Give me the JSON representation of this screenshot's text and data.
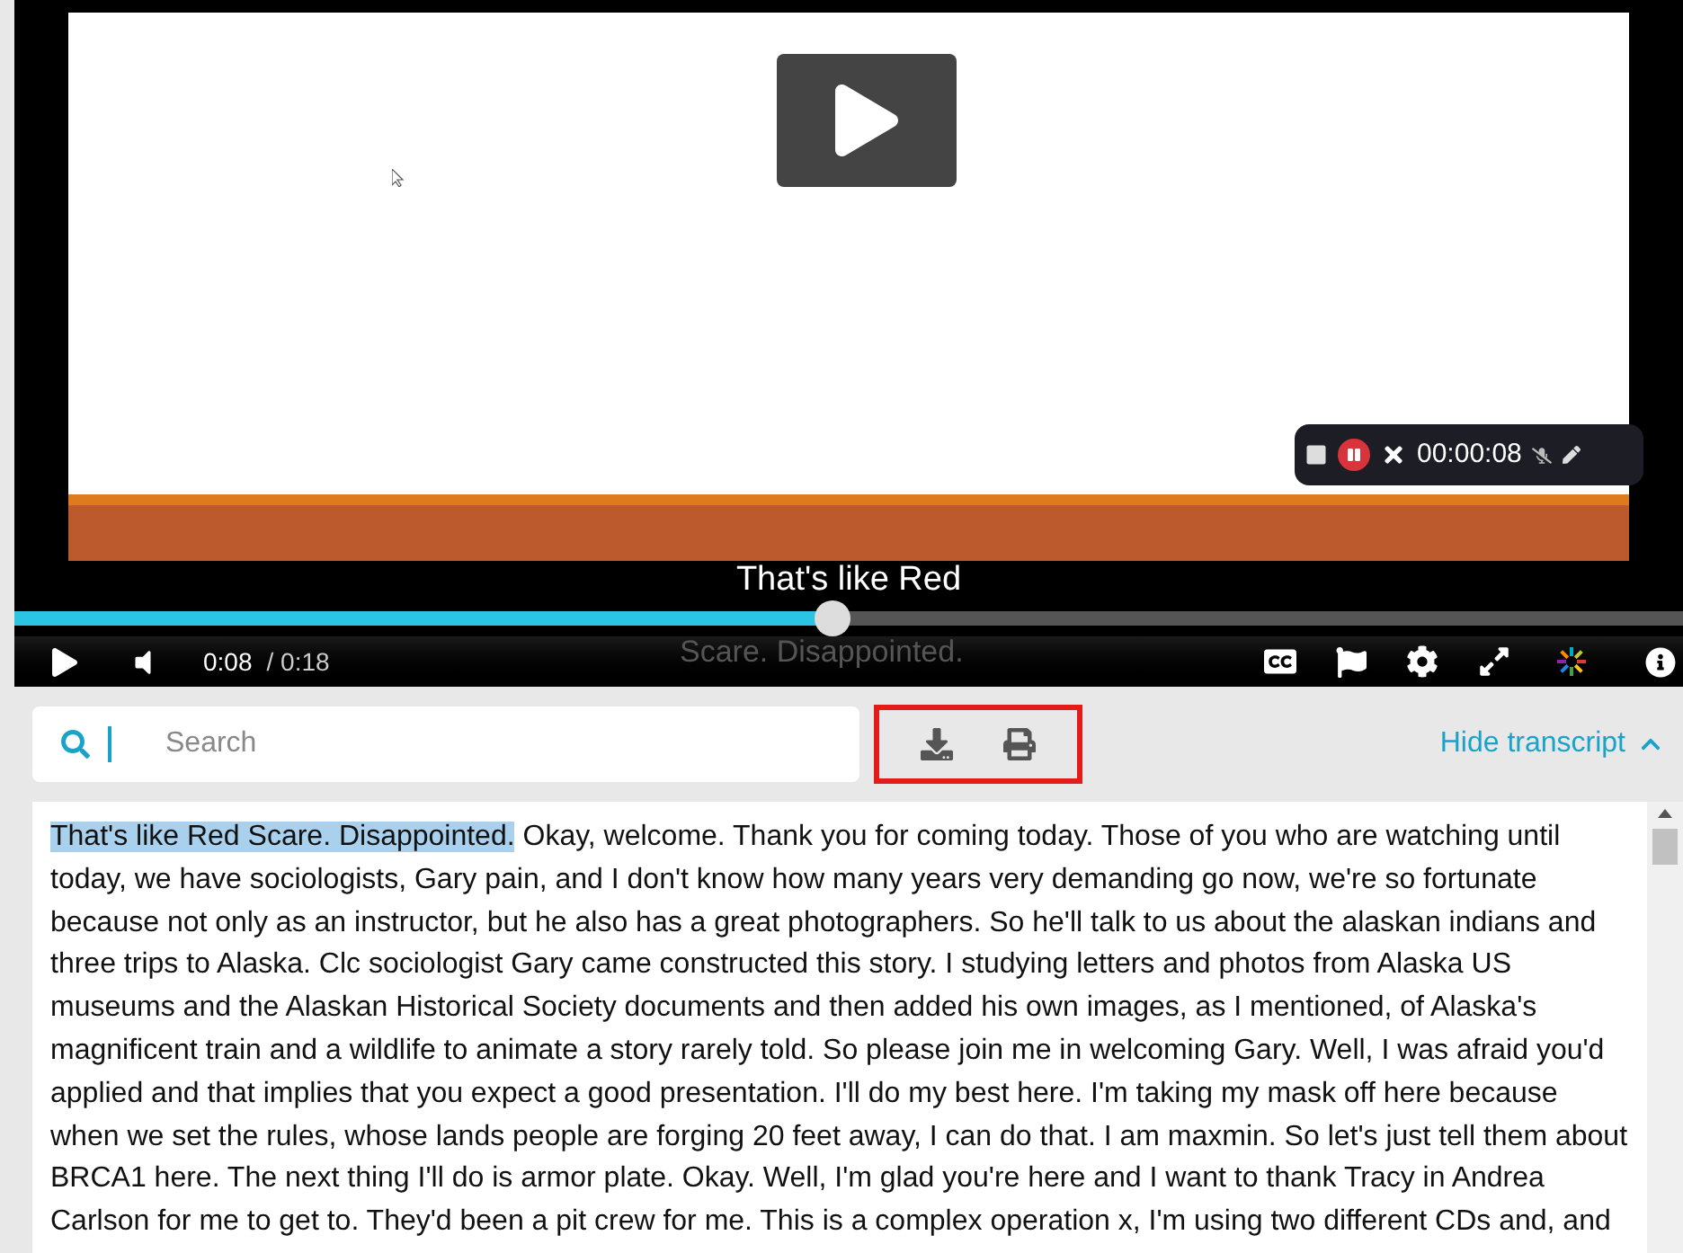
{
  "video": {
    "recorder_time": "00:00:08",
    "caption_lines": [
      "That's like Red",
      "Scare. Disappointed."
    ],
    "level": 0.49,
    "current_time": "0:08",
    "duration": "/ 0:18"
  },
  "toolbar": {
    "search": {
      "placeholder": "Search"
    },
    "hide_link": "Hide transcript"
  },
  "transcript": {
    "segments": [
      {
        "text": "That's like Red Scare. Disappointed.",
        "selected": true
      },
      {
        "text": " Okay, welcome. Thank you for coming today. Those of you who are watching until today, we have sociologists, Gary pain, and I don't know how many years very demanding go now, we're so fortunate because not only as an instructor, but he also has a great photographers. So he'll talk to us about the alaskan indians and three trips to Alaska. Clc sociologist Gary came constructed this story. I studying letters and photos from Alaska US museums and the Alaskan Historical Society documents and then added his own images, as I mentioned, of Alaska's magnificent train and a wildlife to animate a story rarely told. So please join me in welcoming Gary. Well, I was afraid you'd applied and that implies that you expect a good presentation. I'll do my best here. I'm taking my mask off here because when we set the rules, whose lands people are forging 20 feet away, I can do that. I am maxmin. So let's just tell them about BRCA1 here. The next thing I'll do is armor plate. Okay. Well, I'm glad you're here and I want to thank Tracy in Andrea Carlson for me to get to. They'd been a pit crew for me. This is a complex operation x, I'm using two different CDs and, and",
        "selected": false
      }
    ]
  }
}
